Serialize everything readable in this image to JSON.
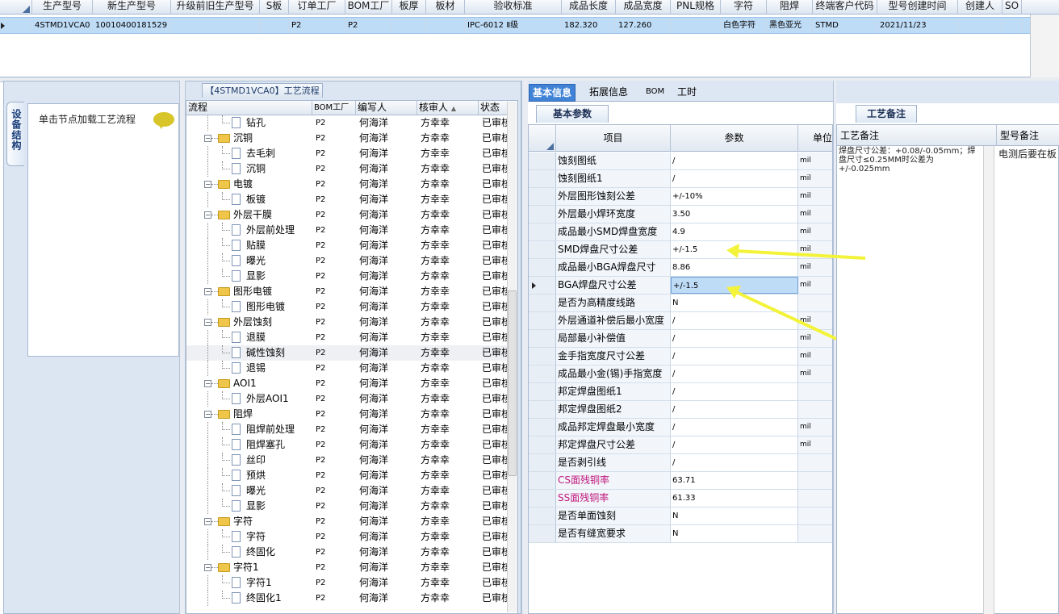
{
  "top_grid": {
    "headers": [
      "生产型号",
      "新生产型号",
      "升级前旧生产型号",
      "S板",
      "订单工厂",
      "BOM工厂",
      "板厚",
      "板材",
      "验收标准",
      "成品长度",
      "成品宽度",
      "PNL规格",
      "字符",
      "阻焊",
      "终端客户代码",
      "型号创建时间",
      "创建人",
      "SO"
    ],
    "row": [
      "4STMD1VCA0",
      "10010400181529",
      "",
      "",
      "P2",
      "P2",
      "",
      "",
      "IPC-6012 Ⅱ级",
      "182.320",
      "127.260",
      "",
      "白色字符",
      "黑色亚光",
      "STMD",
      "2021/11/23",
      "",
      ""
    ]
  },
  "left": {
    "vertical_tab": "设备结构",
    "hint": "单击节点加载工艺流程",
    "tree_tab": "【4STMD1VCA0】工艺流程",
    "tree_headers": [
      "流程",
      "BOM工厂",
      "编写人",
      "核审人",
      "状态"
    ],
    "rows": [
      {
        "level": 0,
        "name": "钻孔",
        "type": "doc"
      },
      {
        "level": 1,
        "name": "沉铜",
        "type": "folder"
      },
      {
        "level": 0,
        "name": "去毛刺",
        "type": "doc"
      },
      {
        "level": 0,
        "name": "沉铜",
        "type": "doc"
      },
      {
        "level": 1,
        "name": "电镀",
        "type": "folder"
      },
      {
        "level": 0,
        "name": "板镀",
        "type": "doc"
      },
      {
        "level": 1,
        "name": "外层干膜",
        "type": "folder"
      },
      {
        "level": 0,
        "name": "外层前处理",
        "type": "doc"
      },
      {
        "level": 0,
        "name": "贴膜",
        "type": "doc"
      },
      {
        "level": 0,
        "name": "曝光",
        "type": "doc"
      },
      {
        "level": 0,
        "name": "显影",
        "type": "doc"
      },
      {
        "level": 1,
        "name": "图形电镀",
        "type": "folder"
      },
      {
        "level": 0,
        "name": "图形电镀",
        "type": "doc"
      },
      {
        "level": 1,
        "name": "外层蚀刻",
        "type": "folder"
      },
      {
        "level": 0,
        "name": "退膜",
        "type": "doc"
      },
      {
        "level": 0,
        "name": "碱性蚀刻",
        "type": "doc",
        "selected": true
      },
      {
        "level": 0,
        "name": "退锡",
        "type": "doc"
      },
      {
        "level": 1,
        "name": "AOI1",
        "type": "folder"
      },
      {
        "level": 0,
        "name": "外层AOI1",
        "type": "doc"
      },
      {
        "level": 1,
        "name": "阻焊",
        "type": "folder"
      },
      {
        "level": 0,
        "name": "阻焊前处理",
        "type": "doc"
      },
      {
        "level": 0,
        "name": "阻焊塞孔",
        "type": "doc"
      },
      {
        "level": 0,
        "name": "丝印",
        "type": "doc"
      },
      {
        "level": 0,
        "name": "预烘",
        "type": "doc"
      },
      {
        "level": 0,
        "name": "曝光",
        "type": "doc"
      },
      {
        "level": 0,
        "name": "显影",
        "type": "doc"
      },
      {
        "level": 1,
        "name": "字符",
        "type": "folder"
      },
      {
        "level": 0,
        "name": "字符",
        "type": "doc"
      },
      {
        "level": 0,
        "name": "终固化",
        "type": "doc"
      },
      {
        "level": 1,
        "name": "字符1",
        "type": "folder"
      },
      {
        "level": 0,
        "name": "字符1",
        "type": "doc"
      },
      {
        "level": 0,
        "name": "终固化1",
        "type": "doc"
      }
    ],
    "row_factory": "P2",
    "row_writer": "何海洋",
    "row_reviewer": "方幸幸",
    "row_status": "已审核"
  },
  "middle": {
    "tabs": [
      "基本信息",
      "拓展信息",
      "BOM",
      "工时"
    ],
    "section_tab": "基本参数",
    "headers": [
      "项目",
      "参数",
      "单位"
    ],
    "rows": [
      {
        "item": "蚀刻图纸",
        "value": "/",
        "unit": "mil"
      },
      {
        "item": "蚀刻图纸1",
        "value": "/",
        "unit": "mil"
      },
      {
        "item": "外层图形蚀刻公差",
        "value": "+/-10%",
        "unit": "mil"
      },
      {
        "item": "外层最小焊环宽度",
        "value": "3.50",
        "unit": "mil"
      },
      {
        "item": "成品最小SMD焊盘宽度",
        "value": "4.9",
        "unit": "mil"
      },
      {
        "item": "SMD焊盘尺寸公差",
        "value": "+/-1.5",
        "unit": "mil"
      },
      {
        "item": "成品最小BGA焊盘尺寸",
        "value": "8.86",
        "unit": "mil"
      },
      {
        "item": "BGA焊盘尺寸公差",
        "value": "+/-1.5",
        "unit": "mil",
        "selected": true
      },
      {
        "item": "是否为高精度线路",
        "value": "N",
        "unit": ""
      },
      {
        "item": "外层通道补偿后最小宽度",
        "value": "/",
        "unit": "mil"
      },
      {
        "item": "局部最小补偿值",
        "value": "/",
        "unit": "mil"
      },
      {
        "item": "金手指宽度尺寸公差",
        "value": "/",
        "unit": "mil"
      },
      {
        "item": "成品最小金(锡)手指宽度",
        "value": "/",
        "unit": "mil"
      },
      {
        "item": "邦定焊盘图纸1",
        "value": "/",
        "unit": ""
      },
      {
        "item": "邦定焊盘图纸2",
        "value": "/",
        "unit": ""
      },
      {
        "item": "成品邦定焊盘最小宽度",
        "value": "/",
        "unit": "mil"
      },
      {
        "item": "邦定焊盘尺寸公差",
        "value": "/",
        "unit": "mil"
      },
      {
        "item": "是否剥引线",
        "value": "/",
        "unit": ""
      },
      {
        "item": "CS面残铜率",
        "value": "63.71",
        "unit": "",
        "pink": true
      },
      {
        "item": "SS面残铜率",
        "value": "61.33",
        "unit": "",
        "pink": true
      },
      {
        "item": "是否单面蚀刻",
        "value": "N",
        "unit": ""
      },
      {
        "item": "是否有缝宽要求",
        "value": "N",
        "unit": ""
      }
    ]
  },
  "right": {
    "section_tab": "工艺备注",
    "headers": [
      "工艺备注",
      "型号备注"
    ],
    "process_note": "焊盘尺寸公差：+0.08/-0.05mm；焊盘尺寸≤0.25MM时公差为+/-0.025mm",
    "model_note": "电测后要在板"
  },
  "colors": {
    "accent": "#3f82d6",
    "selection": "#bfdcf7",
    "arrow": "#f3f33a",
    "pink": "#c0177b"
  }
}
